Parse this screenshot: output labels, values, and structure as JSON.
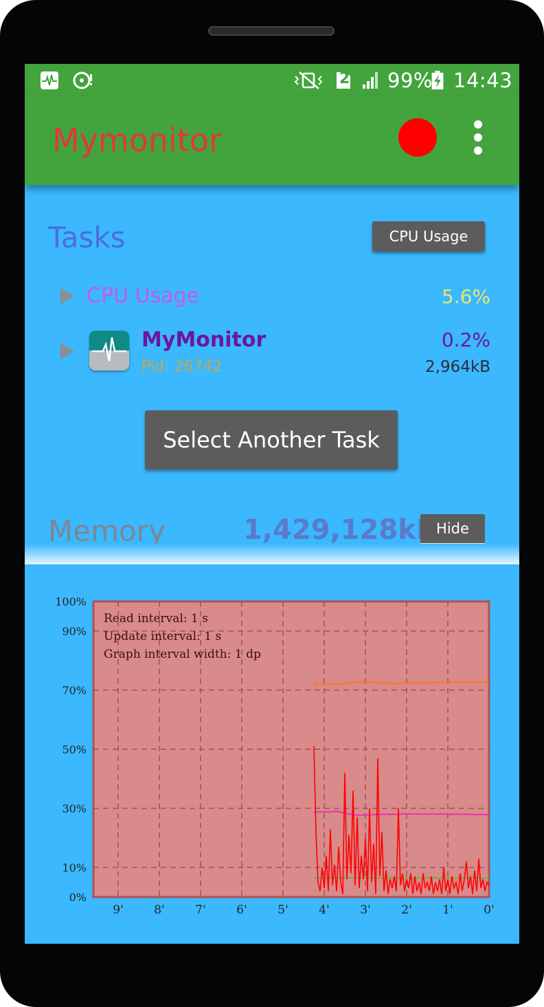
{
  "status_bar": {
    "sim_slot": "2",
    "battery": "99%",
    "time": "14:43",
    "icons": [
      "pulse-app-icon",
      "disc-alert-icon",
      "vibrate-icon",
      "sim-icon",
      "signal-icon",
      "battery-charging-icon"
    ]
  },
  "appbar": {
    "title": "Mymonitor",
    "record_color": "#ff0000",
    "title_color": "#e23838",
    "bg_color": "#43a43e"
  },
  "tasks": {
    "title": "Tasks",
    "mode_button": "CPU Usage",
    "summary_label": "CPU Usage",
    "summary_value": "5.6%",
    "process": {
      "name": "MyMonitor",
      "pid": "Pid: 26742",
      "cpu": "0.2%",
      "memory": "2,964kB"
    },
    "select_button": "Select Another Task"
  },
  "memory": {
    "title": "Memory",
    "value": "1,429,128kB",
    "hide_button": "Hide"
  },
  "chart_data": {
    "type": "line",
    "annotations": [
      "Read interval: 1 s",
      "Update interval: 1 s",
      "Graph interval width: 1 dp"
    ],
    "y_tick_labels": [
      "100%",
      "90%",
      "70%",
      "50%",
      "30%",
      "10%",
      "0%"
    ],
    "y_ticks": [
      100,
      90,
      70,
      50,
      30,
      10,
      0
    ],
    "ylim": [
      0,
      100
    ],
    "x_tick_labels": [
      "9'",
      "8'",
      "7'",
      "6'",
      "5'",
      "4'",
      "3'",
      "2'",
      "1'",
      "0'"
    ],
    "x_ticks": [
      9,
      8,
      7,
      6,
      5,
      4,
      3,
      2,
      1,
      0
    ],
    "xlim": [
      9.6,
      0
    ],
    "grid": true,
    "background": "#d98a8a",
    "series": [
      {
        "color": "#f57c1f",
        "x": [
          4.25,
          4.2,
          4.1,
          3.9,
          3.7,
          3.5,
          3.3,
          3.1,
          2.9,
          2.7,
          2.5,
          2.3,
          2.1,
          1.9,
          1.7,
          1.5,
          1.3,
          1.1,
          0.9,
          0.7,
          0.5,
          0.3,
          0.1,
          0.0
        ],
        "values": [
          71.5,
          72.8,
          71.8,
          72.1,
          72.0,
          72.3,
          72.6,
          72.8,
          72.7,
          72.6,
          72.4,
          72.1,
          72.5,
          72.5,
          72.5,
          72.5,
          72.6,
          72.5,
          72.6,
          72.6,
          72.6,
          72.7,
          72.6,
          72.6
        ]
      },
      {
        "color": "#ee2fb4",
        "x": [
          4.25,
          4.1,
          3.9,
          3.7,
          3.5,
          3.3,
          3.1,
          2.9,
          2.7,
          2.5,
          2.3,
          2.1,
          1.9,
          1.7,
          1.5,
          1.3,
          1.1,
          0.9,
          0.7,
          0.5,
          0.3,
          0.1,
          0.0
        ],
        "values": [
          28.6,
          28.9,
          28.8,
          29.0,
          28.4,
          27.8,
          27.7,
          27.8,
          27.9,
          28.0,
          28.0,
          28.1,
          28.1,
          28.1,
          28.1,
          28.1,
          28.1,
          28.0,
          28.0,
          28.0,
          27.9,
          27.9,
          27.8
        ]
      },
      {
        "color": "#6ab04c",
        "x": [
          4.25,
          0.0
        ],
        "values": [
          6.5,
          6.5
        ]
      },
      {
        "color": "#ff0000",
        "x": [
          4.25,
          4.2,
          4.15,
          4.1,
          4.05,
          4.0,
          3.95,
          3.9,
          3.85,
          3.8,
          3.75,
          3.7,
          3.65,
          3.6,
          3.55,
          3.5,
          3.45,
          3.4,
          3.35,
          3.3,
          3.25,
          3.2,
          3.15,
          3.1,
          3.05,
          3.0,
          2.95,
          2.9,
          2.85,
          2.8,
          2.75,
          2.7,
          2.65,
          2.6,
          2.55,
          2.5,
          2.45,
          2.4,
          2.35,
          2.3,
          2.25,
          2.2,
          2.15,
          2.1,
          2.05,
          2.0,
          1.95,
          1.9,
          1.85,
          1.8,
          1.75,
          1.7,
          1.65,
          1.6,
          1.55,
          1.5,
          1.45,
          1.4,
          1.35,
          1.3,
          1.25,
          1.2,
          1.15,
          1.1,
          1.05,
          1.0,
          0.95,
          0.9,
          0.85,
          0.8,
          0.75,
          0.7,
          0.65,
          0.6,
          0.55,
          0.5,
          0.45,
          0.4,
          0.35,
          0.3,
          0.25,
          0.2,
          0.15,
          0.1,
          0.05,
          0.0
        ],
        "values": [
          51,
          22,
          5,
          2,
          10,
          3,
          14,
          2,
          23,
          4,
          11,
          2,
          17,
          5,
          1,
          42,
          6,
          21,
          8,
          36,
          4,
          27,
          3,
          14,
          6,
          20,
          2,
          30,
          5,
          18,
          1,
          47,
          7,
          22,
          2,
          9,
          1,
          6,
          3,
          7,
          2,
          30,
          4,
          8,
          2,
          6,
          3,
          8,
          1,
          7,
          2,
          5,
          1,
          8,
          3,
          5,
          2,
          7,
          1,
          5,
          2,
          6,
          1,
          10,
          2,
          6,
          1,
          7,
          3,
          5,
          1,
          8,
          2,
          6,
          12,
          3,
          7,
          1,
          9,
          2,
          13,
          3,
          6,
          2,
          5,
          4
        ]
      }
    ]
  }
}
